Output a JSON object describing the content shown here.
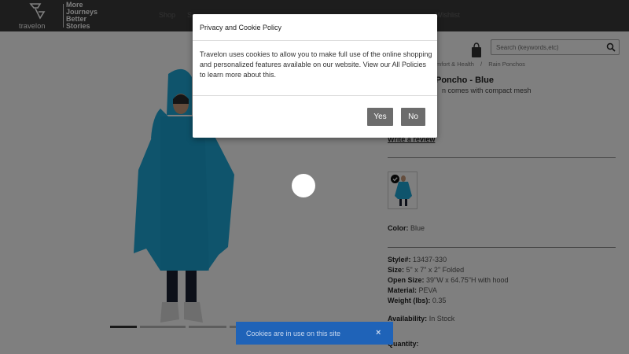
{
  "header": {
    "logo_text": "travelon",
    "tagline": [
      "More",
      "Journeys",
      "Better",
      "Stories"
    ]
  },
  "nav": {
    "shop": "Shop",
    "second_item": "S",
    "wishlist": "Wishlist"
  },
  "search": {
    "placeholder": "Search (keywords,etc)"
  },
  "breadcrumb": {
    "items": [
      "mfort & Health",
      "Rain Ponchos"
    ],
    "separator": "/"
  },
  "product": {
    "title": "Poncho - Blue",
    "description": "n comes with compact mesh",
    "write_review": "Write a review",
    "color_label": "Color:",
    "color_value": "Blue",
    "specs": {
      "style_label": "Style#:",
      "style_value": "13437-330",
      "size_label": "Size:",
      "size_value": "5\" x 7\" x 2\" Folded",
      "open_size_label": "Open Size:",
      "open_size_value": "39\"W x 64.75\"H with hood",
      "material_label": "Material:",
      "material_value": "PEVA",
      "weight_label": "Weight (lbs):",
      "weight_value": "0.35"
    },
    "availability_label": "Availability:",
    "availability_value": "In Stock",
    "quantity_label": "Quantity:"
  },
  "modal": {
    "title": "Privacy and Cookie Policy",
    "body": "Travelon uses cookies to allow you to make full use of the online shopping and personalized features available on our website. View our All Policies to learn more about this.",
    "yes_label": "Yes",
    "no_label": "No"
  },
  "cookie_bar": {
    "text": "Cookies are in use on this site",
    "close_glyph": "×"
  },
  "colors": {
    "header_bg": "#3a3a3a",
    "poncho": "#1ea8d8",
    "button_bg": "#6c6c6c",
    "cookie_bar_bg": "#1f63b8"
  },
  "icons": [
    "travelon-logo-icon",
    "cart-icon",
    "search-icon",
    "chevron-left-icon",
    "chevron-right-icon",
    "check-icon",
    "close-icon"
  ]
}
